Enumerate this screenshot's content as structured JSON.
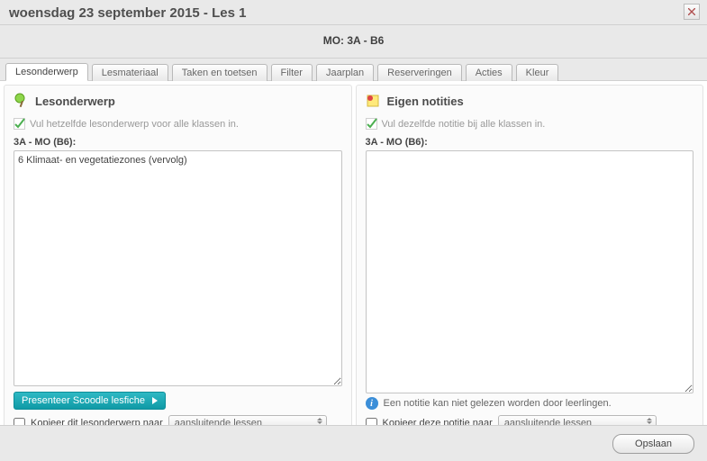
{
  "header": {
    "title": "woensdag 23 september 2015 - Les 1",
    "subtitle": "MO: 3A - B6"
  },
  "tabs": [
    {
      "label": "Lesonderwerp",
      "active": true
    },
    {
      "label": "Lesmateriaal",
      "active": false
    },
    {
      "label": "Taken en toetsen",
      "active": false
    },
    {
      "label": "Filter",
      "active": false
    },
    {
      "label": "Jaarplan",
      "active": false
    },
    {
      "label": "Reserveringen",
      "active": false
    },
    {
      "label": "Acties",
      "active": false
    },
    {
      "label": "Kleur",
      "active": false
    }
  ],
  "left": {
    "heading": "Lesonderwerp",
    "fill_all_label": "Vul hetzelfde lesonderwerp voor alle klassen in.",
    "field_label": "3A - MO (B6):",
    "textarea_value": "6 Klimaat- en vegetatiezones (vervolg)",
    "present_button": "Presenteer Scoodle lesfiche",
    "copy_label": "Kopieer dit lesonderwerp naar",
    "copy_select": "aansluitende lessen"
  },
  "right": {
    "heading": "Eigen notities",
    "fill_all_label": "Vul dezelfde notitie bij alle klassen in.",
    "field_label": "3A - MO (B6):",
    "textarea_value": "",
    "info_text": "Een notitie kan niet gelezen worden door leerlingen.",
    "copy_label": "Kopieer deze notitie naar",
    "copy_select": "aansluitende lessen"
  },
  "footer": {
    "save_label": "Opslaan"
  }
}
